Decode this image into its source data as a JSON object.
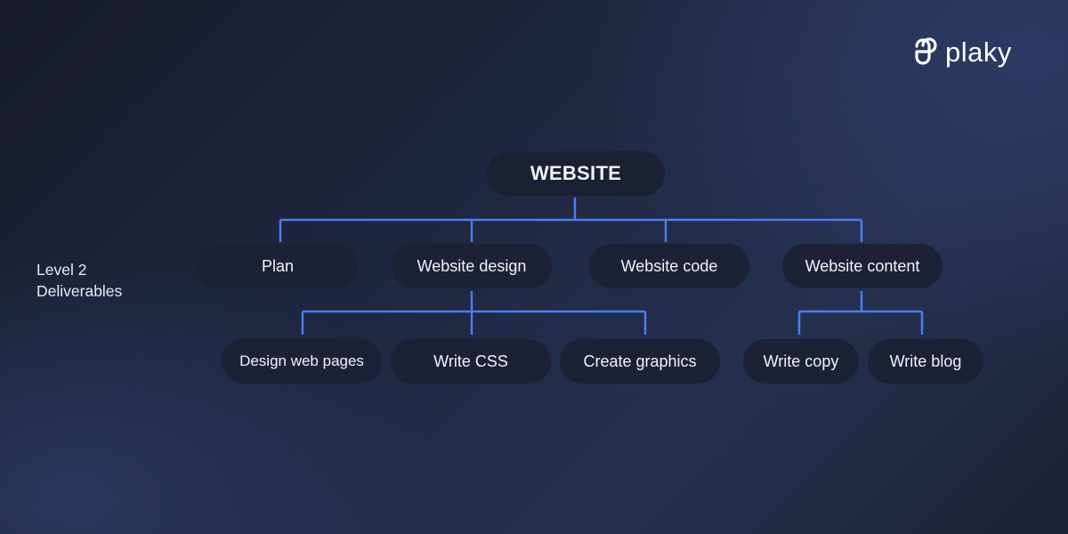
{
  "brand": {
    "name": "plaky",
    "icon": "plaky-logo-icon"
  },
  "side_label": {
    "line1": "Level 2",
    "line2": "Deliverables"
  },
  "colors": {
    "connector": "#4a7ef0",
    "node_bg": "#1c2135",
    "text": "#f2f3f7"
  },
  "tree": {
    "root": "WEBSITE",
    "level2": [
      {
        "label": "Plan",
        "children": []
      },
      {
        "label": "Website design",
        "children": [
          "Design web pages",
          "Write CSS",
          "Create graphics"
        ]
      },
      {
        "label": "Website code",
        "children": []
      },
      {
        "label": "Website content",
        "children": [
          "Write copy",
          "Write blog"
        ]
      }
    ]
  }
}
